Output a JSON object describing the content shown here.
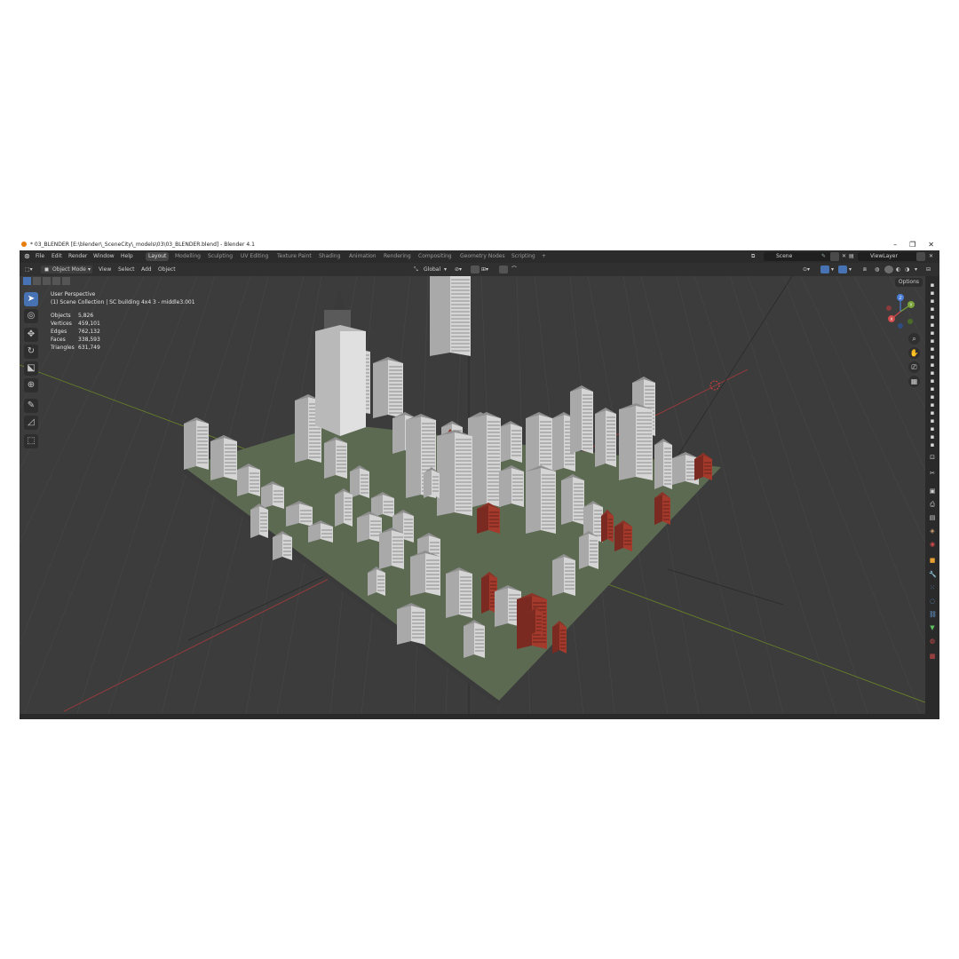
{
  "window": {
    "title": "* 03_BLENDER [E:\\blender\\_SceneCity\\_models\\03\\03_BLENDER.blend] - Blender 4.1",
    "controls": [
      "–",
      "❐",
      "✕"
    ]
  },
  "menu": [
    "File",
    "Edit",
    "Render",
    "Window",
    "Help"
  ],
  "workspaces": [
    "Layout",
    "Modelling",
    "Sculpting",
    "UV Editing",
    "Texture Paint",
    "Shading",
    "Animation",
    "Rendering",
    "Compositing",
    "Geometry Nodes",
    "Scripting"
  ],
  "active_workspace": "Layout",
  "scene_field": "Scene",
  "view_layer_field": "ViewLayer",
  "header": {
    "mode": "Object Mode",
    "menus": [
      "View",
      "Select",
      "Add",
      "Object"
    ],
    "orientation": "Global",
    "options": "Options"
  },
  "overlay": {
    "view_name": "User Perspective",
    "collection": "(1) Scene Collection | SC building 4x4 3 - middle3.001",
    "stats": [
      {
        "label": "Objects",
        "value": "5,826"
      },
      {
        "label": "Vertices",
        "value": "459,101"
      },
      {
        "label": "Edges",
        "value": "762,132"
      },
      {
        "label": "Faces",
        "value": "338,593"
      },
      {
        "label": "Triangles",
        "value": "631,749"
      }
    ]
  },
  "gizmo": {
    "z": "Z",
    "y": "Y",
    "x": "X"
  },
  "colors": {
    "viewport_bg": "#3c3c3c",
    "grid": "#474747",
    "x_axis": "#a23a3a",
    "y_axis": "#6b8a25",
    "accent": "#4772b3",
    "brick": "#a33a2c",
    "building": "#d5d5d5"
  }
}
